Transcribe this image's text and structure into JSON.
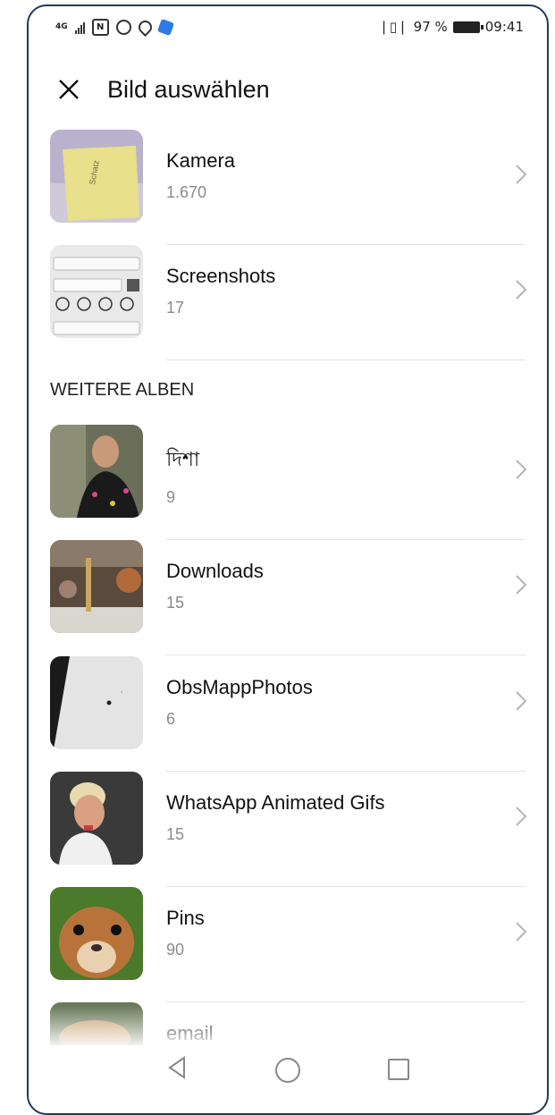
{
  "status_bar": {
    "network_label": "4G",
    "nfc_label": "N",
    "battery_percent": "97 %",
    "time": "09:41"
  },
  "app_bar": {
    "title": "Bild auswählen"
  },
  "albums": [
    {
      "name": "Kamera",
      "count": "1.670"
    },
    {
      "name": "Screenshots",
      "count": "17"
    }
  ],
  "section_header": "WEITERE ALBEN",
  "more_albums": [
    {
      "name": "দিশা",
      "count": "9"
    },
    {
      "name": "Downloads",
      "count": "15"
    },
    {
      "name": "ObsMappPhotos",
      "count": "6"
    },
    {
      "name": "WhatsApp Animated Gifs",
      "count": "15"
    },
    {
      "name": "Pins",
      "count": "90"
    },
    {
      "name": "email",
      "count": ""
    }
  ],
  "colors": {
    "frame": "#1f3a5c",
    "text_primary": "#111111",
    "text_secondary": "#8a8a8a",
    "divider": "#e3e3e3"
  }
}
